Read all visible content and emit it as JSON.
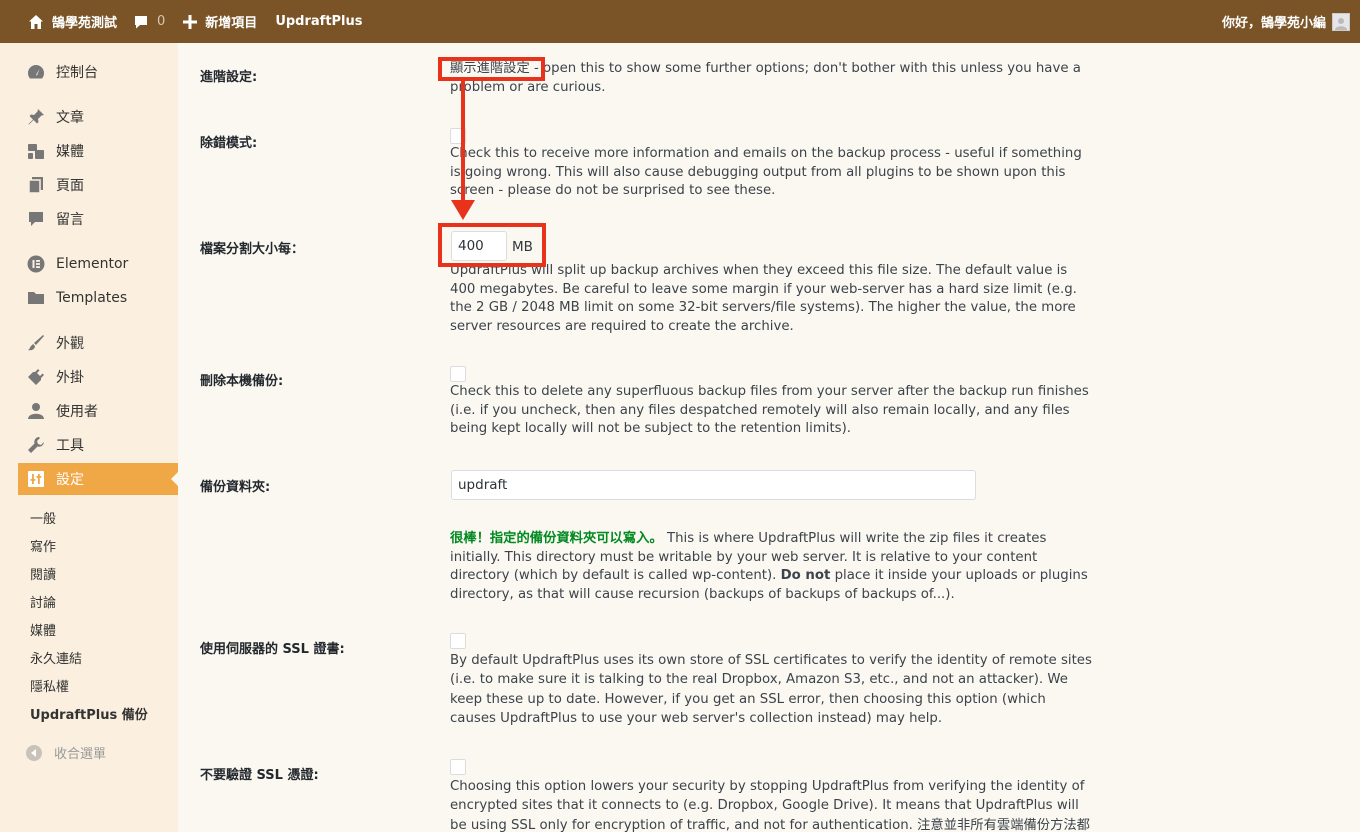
{
  "adminbar": {
    "site_name": "鵠學苑測試",
    "comments_count": "0",
    "new_item": "新增項目",
    "plugin": "UpdraftPlus",
    "greeting": "你好，鵠學苑小編"
  },
  "sidebar": {
    "items": [
      {
        "label": "控制台",
        "icon": "dashboard-icon"
      },
      {
        "label": "文章",
        "icon": "pin-icon"
      },
      {
        "label": "媒體",
        "icon": "media-icon"
      },
      {
        "label": "頁面",
        "icon": "page-icon"
      },
      {
        "label": "留言",
        "icon": "comment-icon"
      },
      {
        "label": "Elementor",
        "icon": "elementor-icon"
      },
      {
        "label": "Templates",
        "icon": "folder-icon"
      },
      {
        "label": "外觀",
        "icon": "brush-icon"
      },
      {
        "label": "外掛",
        "icon": "plugin-icon"
      },
      {
        "label": "使用者",
        "icon": "user-icon"
      },
      {
        "label": "工具",
        "icon": "wrench-icon"
      },
      {
        "label": "設定",
        "icon": "settings-icon"
      }
    ],
    "submenu": [
      "一般",
      "寫作",
      "閱讀",
      "討論",
      "媒體",
      "永久連結",
      "隱私權",
      "UpdraftPlus 備份"
    ],
    "collapse": "收合選單"
  },
  "settings": {
    "advanced": {
      "label": "進階設定:",
      "link": "顯示進階設定",
      "desc_line1": " - open this to show some further options; don't bother with this unless you have a",
      "desc_line2": "problem or are curious."
    },
    "debug": {
      "label": "除錯模式:",
      "desc": "Check this to receive more information and emails on the backup process - useful if something is going wrong. This will also cause debugging output from all plugins to be shown upon this screen - please do not be surprised to see these."
    },
    "split": {
      "label": "檔案分割大小每：",
      "value": "400",
      "unit": "MB",
      "desc": "UpdraftPlus will split up backup archives when they exceed this file size. The default value is 400 megabytes. Be careful to leave some margin if your web-server has a hard size limit (e.g. the 2 GB / 2048 MB limit on some 32-bit servers/file systems). The higher the value, the more server resources are required to create the archive."
    },
    "delete_local": {
      "label": "刪除本機備份:",
      "desc": "Check this to delete any superfluous backup files from your server after the backup run finishes (i.e. if you uncheck, then any files despatched remotely will also remain locally, and any files being kept locally will not be subject to the retention limits)."
    },
    "backup_dir": {
      "label": "備份資料夾:",
      "value": "updraft",
      "ok_msg": "很棒！指定的備份資料夾可以寫入。",
      "desc_a": "This is where UpdraftPlus will write the zip files it creates initially. This directory must be writable by your web server. It is relative to your content directory (which by default is called wp-content). ",
      "desc_bold": "Do not",
      "desc_b": " place it inside your uploads or plugins directory, as that will cause recursion (backups of backups of backups of...)."
    },
    "server_ssl": {
      "label": "使用伺服器的 SSL 證書:",
      "desc": "By default UpdraftPlus uses its own store of SSL certificates to verify the identity of remote sites (i.e. to make sure it is talking to the real Dropbox, Amazon S3, etc., and not an attacker). We keep these up to date. However, if you get an SSL error, then choosing this option (which causes UpdraftPlus to use your web server's collection instead) may help."
    },
    "no_verify_ssl": {
      "label": "不要驗證 SSL 憑證:",
      "desc": "Choosing this option lowers your security by stopping UpdraftPlus from verifying the identity of encrypted sites that it connects to (e.g. Dropbox, Google Drive). It means that UpdraftPlus will be using SSL only for encryption of traffic, and not for authentication. 注意並非所有雲端備份方法都需"
    }
  },
  "colors": {
    "adminbar": "#7a5427",
    "sidebar": "#fbf0df",
    "accent": "#f0a745",
    "annotation": "#e8321c",
    "ok": "#008a20"
  }
}
